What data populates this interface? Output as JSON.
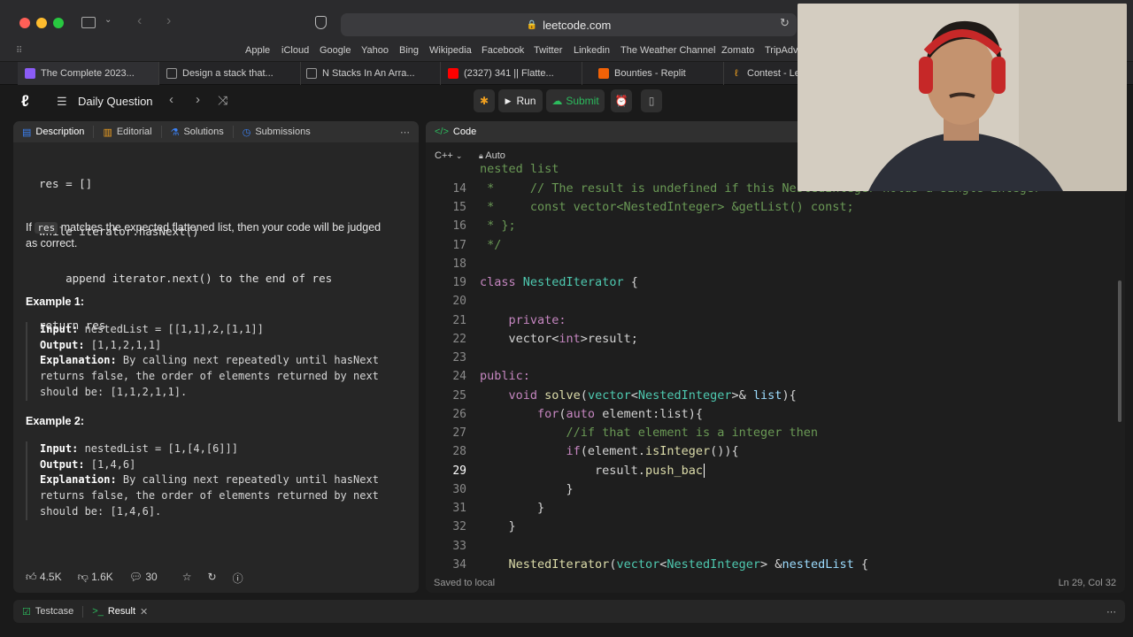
{
  "browser": {
    "url": "leetcode.com",
    "favorites": [
      "Apple",
      "iCloud",
      "Google",
      "Yahoo",
      "Bing",
      "Wikipedia",
      "Facebook",
      "Twitter",
      "Linkedin",
      "The Weather Channel",
      "Zomato",
      "TripAdvi"
    ],
    "tabs": [
      "The Complete 2023...",
      "Design a stack that...",
      "N Stacks In An Arra...",
      "(2327) 341 || Flatte...",
      "Bounties - Replit",
      "Contest - Le"
    ]
  },
  "nav": {
    "daily_label": "Daily Question",
    "run_label": "Run",
    "submit_label": "Submit"
  },
  "left": {
    "tabs": [
      "Description",
      "Editorial",
      "Solutions",
      "Submissions"
    ],
    "pseudo_code": [
      "res = []",
      "while iterator.hasNext()",
      "    append iterator.next() to the end of res",
      "return res"
    ],
    "judge_text_1": "If ",
    "judge_code": "res",
    "judge_text_2": " matches the expected flattened list, then your code will be judged",
    "judge_text_3": "as correct.",
    "example1_title": "Example 1:",
    "example1": {
      "input_label": "Input:",
      "input": " nestedList = [[1,1],2,[1,1]]",
      "output_label": "Output:",
      "output": " [1,1,2,1,1]",
      "expl_label": "Explanation:",
      "expl_1": " By calling next repeatedly until hasNext",
      "expl_2": "returns false, the order of elements returned by next",
      "expl_3": "should be: [1,1,2,1,1]."
    },
    "example2_title": "Example 2:",
    "example2": {
      "input_label": "Input:",
      "input": " nestedList = [1,[4,[6]]]",
      "output_label": "Output:",
      "output": " [1,4,6]",
      "expl_label": "Explanation:",
      "expl_1": " By calling next repeatedly until hasNext",
      "expl_2": "returns false, the order of elements returned by next",
      "expl_3": "should be: [1,4,6]."
    },
    "likes": "4.5K",
    "dislikes": "1.6K",
    "comments": "30"
  },
  "editor": {
    "tab_label": "Code",
    "language": "C++",
    "mode": "Auto",
    "partial_top": "nested list",
    "line_numbers": [
      "14",
      "15",
      "16",
      "17",
      "18",
      "19",
      "20",
      "21",
      "22",
      "23",
      "24",
      "25",
      "26",
      "27",
      "28",
      "29",
      "30",
      "31",
      "32",
      "33",
      "34"
    ],
    "current_line": "29",
    "saved": "Saved to local",
    "cursor_pos": "Ln 29, Col 32"
  },
  "console": {
    "testcase_label": "Testcase",
    "result_label": "Result"
  }
}
